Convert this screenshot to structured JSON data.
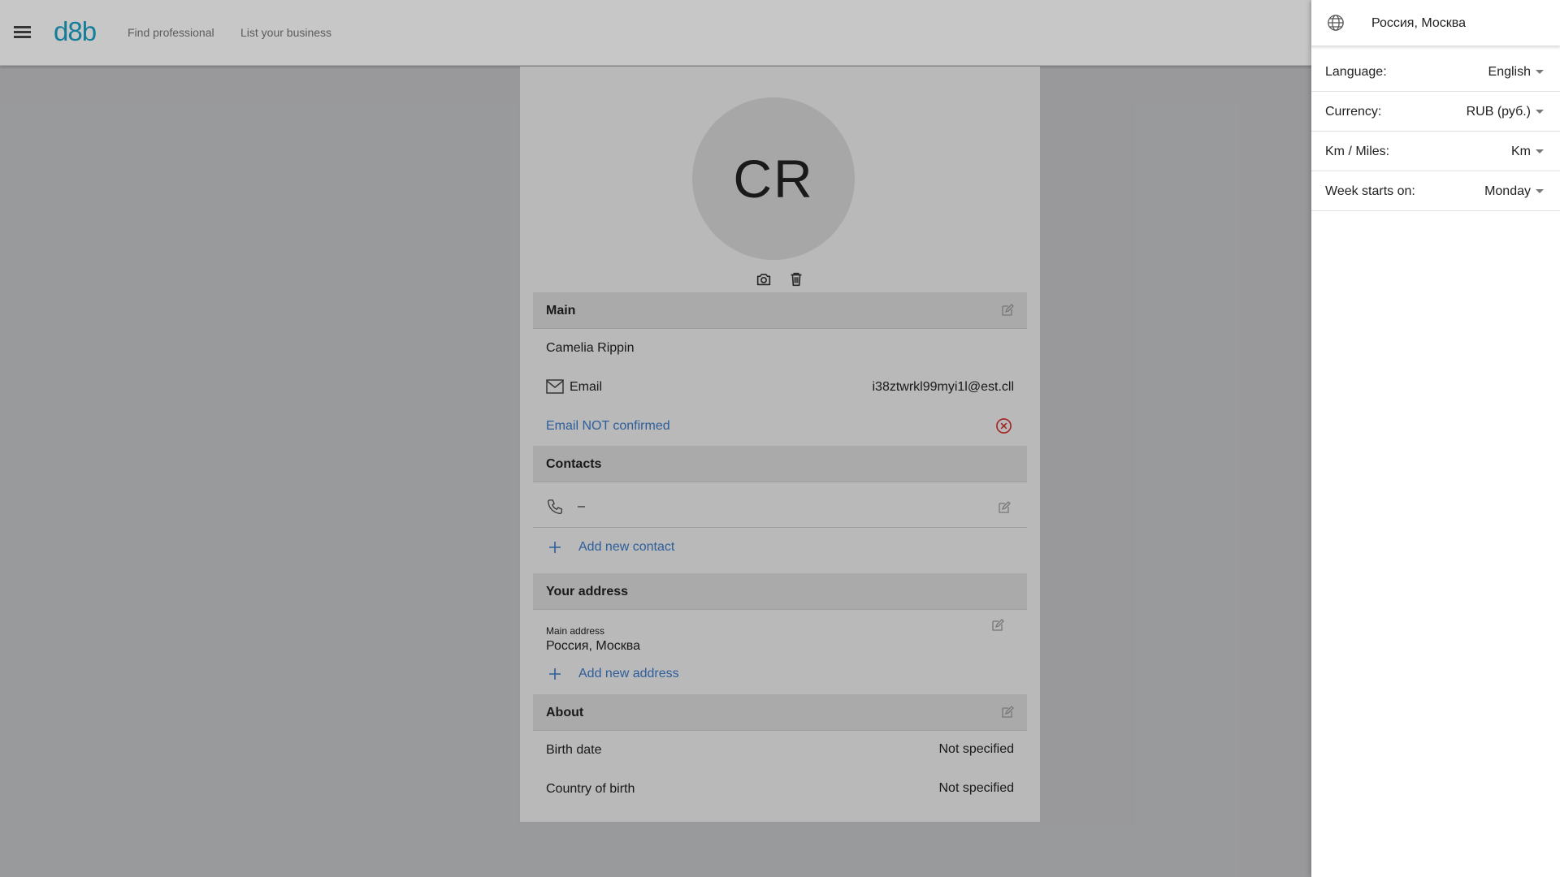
{
  "header": {
    "logo": "d8b",
    "nav": [
      "Find professional",
      "List your business"
    ]
  },
  "profile": {
    "initials": "CR",
    "main": {
      "title": "Main",
      "name": "Camelia Rippin",
      "email_label": "Email",
      "email_value": "i38ztwrkl99myi1l@est.cll",
      "email_status": "Email NOT confirmed"
    },
    "contacts": {
      "title": "Contacts",
      "phone_value": "–",
      "add_label": "Add new contact"
    },
    "address": {
      "title": "Your address",
      "main_label": "Main address",
      "main_value": "Россия, Москва",
      "add_label": "Add new address"
    },
    "about": {
      "title": "About",
      "birth_date_label": "Birth date",
      "birth_date_value": "Not specified",
      "country_label": "Country of birth",
      "country_value": "Not specified"
    }
  },
  "settings_panel": {
    "location": "Россия, Москва",
    "rows": [
      {
        "label": "Language:",
        "value": "English"
      },
      {
        "label": "Currency:",
        "value": "RUB (руб.)"
      },
      {
        "label": "Km / Miles:",
        "value": "Km"
      },
      {
        "label": "Week starts on:",
        "value": "Monday"
      }
    ]
  },
  "colors": {
    "brand": "#1aa0c2",
    "link": "#3a79c8",
    "error": "#d32f2f"
  }
}
